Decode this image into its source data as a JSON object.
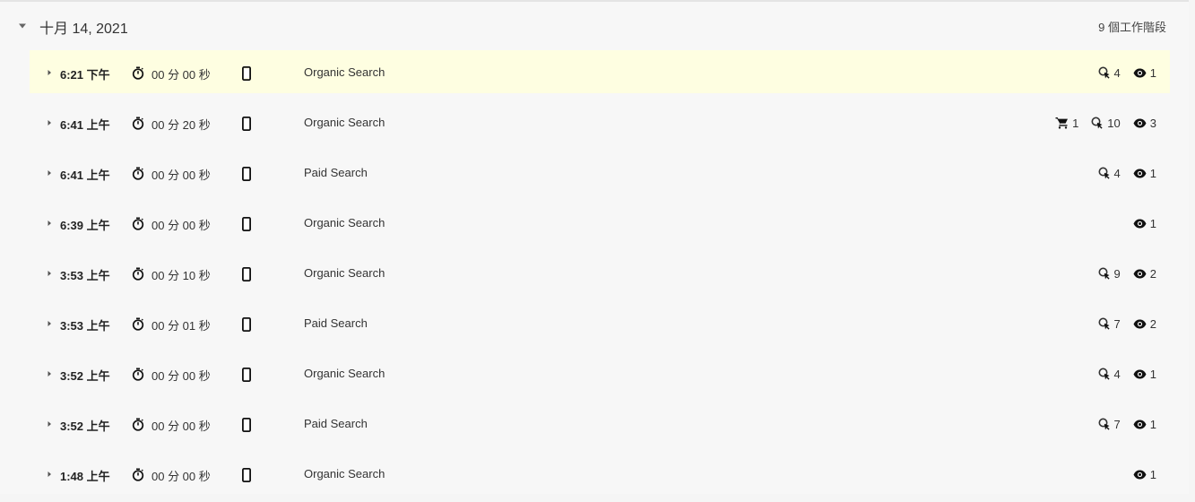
{
  "day": {
    "title": "十月 14, 2021",
    "session_count": "9 個工作階段"
  },
  "sessions": [
    {
      "time": "6:21 下午",
      "duration": "00 分 00 秒",
      "channel": "Organic Search",
      "cart": null,
      "clicks": "4",
      "views": "1",
      "highlighted": true
    },
    {
      "time": "6:41 上午",
      "duration": "00 分 20 秒",
      "channel": "Organic Search",
      "cart": "1",
      "clicks": "10",
      "views": "3",
      "highlighted": false
    },
    {
      "time": "6:41 上午",
      "duration": "00 分 00 秒",
      "channel": "Paid Search",
      "cart": null,
      "clicks": "4",
      "views": "1",
      "highlighted": false
    },
    {
      "time": "6:39 上午",
      "duration": "00 分 00 秒",
      "channel": "Organic Search",
      "cart": null,
      "clicks": null,
      "views": "1",
      "highlighted": false
    },
    {
      "time": "3:53 上午",
      "duration": "00 分 10 秒",
      "channel": "Organic Search",
      "cart": null,
      "clicks": "9",
      "views": "2",
      "highlighted": false
    },
    {
      "time": "3:53 上午",
      "duration": "00 分 01 秒",
      "channel": "Paid Search",
      "cart": null,
      "clicks": "7",
      "views": "2",
      "highlighted": false
    },
    {
      "time": "3:52 上午",
      "duration": "00 分 00 秒",
      "channel": "Organic Search",
      "cart": null,
      "clicks": "4",
      "views": "1",
      "highlighted": false
    },
    {
      "time": "3:52 上午",
      "duration": "00 分 00 秒",
      "channel": "Paid Search",
      "cart": null,
      "clicks": "7",
      "views": "1",
      "highlighted": false
    },
    {
      "time": "1:48 上午",
      "duration": "00 分 00 秒",
      "channel": "Organic Search",
      "cart": null,
      "clicks": null,
      "views": "1",
      "highlighted": false
    }
  ],
  "icons": {
    "expand": "caret-right-icon",
    "collapse": "caret-down-icon",
    "duration": "stopwatch-icon",
    "device": "smartphone-icon",
    "cart": "cart-icon",
    "clicks": "click-icon",
    "views": "eye-icon"
  },
  "colors": {
    "highlight_row": "#fefee1",
    "background": "#f7f7f7"
  }
}
